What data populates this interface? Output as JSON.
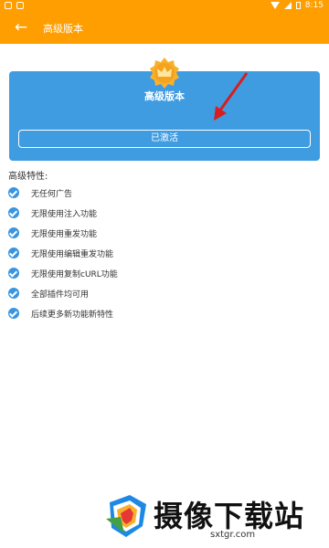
{
  "status_bar": {
    "time": "8:15"
  },
  "app_bar": {
    "back_icon": "arrow-left-icon",
    "title": "高级版本"
  },
  "card": {
    "title": "高级版本",
    "button_label": "已激活",
    "badge_icon": "crown-icon",
    "color": "#3f9ce1"
  },
  "features": {
    "heading": "高级特性:",
    "items": [
      "无任何广告",
      "无限使用注入功能",
      "无限使用重发功能",
      "无限使用编辑重发功能",
      "无限使用复制cURL功能",
      "全部插件均可用",
      "后续更多新功能新特性"
    ]
  },
  "watermark": {
    "brand": "摄像下载站",
    "url": "sxtgr.com"
  },
  "colors": {
    "accent": "#ff9e00",
    "check": "#3a95e0"
  }
}
